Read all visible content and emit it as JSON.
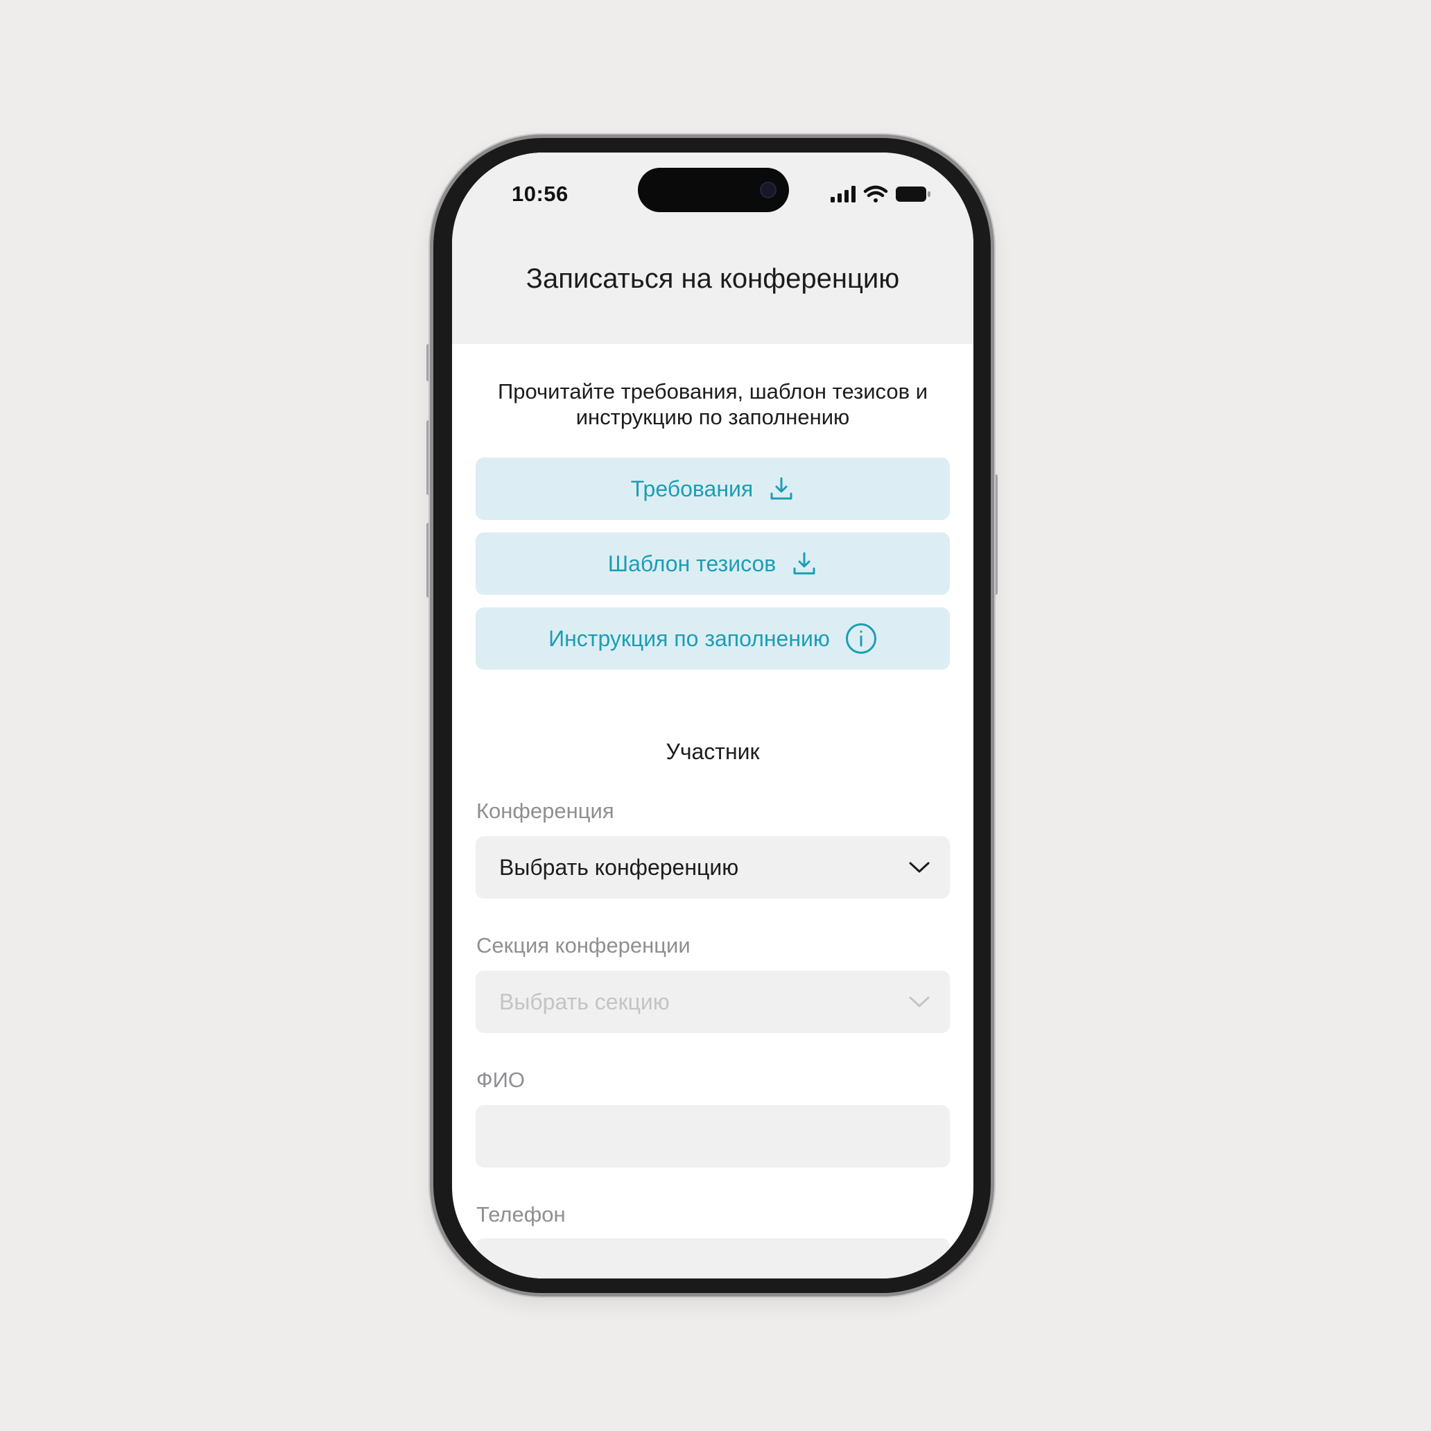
{
  "status_bar": {
    "time": "10:56",
    "icons": [
      "cellular-signal-icon",
      "wifi-icon",
      "battery-icon"
    ]
  },
  "header": {
    "title": "Записаться на конференцию"
  },
  "intro": {
    "text": "Прочитайте требования, шаблон тезисов и инструкцию по заполнению"
  },
  "document_buttons": [
    {
      "label": "Требования",
      "icon": "download-icon"
    },
    {
      "label": "Шаблон тезисов",
      "icon": "download-icon"
    },
    {
      "label": "Инструкция по заполнению",
      "icon": "info-icon"
    }
  ],
  "participant": {
    "heading": "Участник",
    "fields": [
      {
        "label": "Конференция",
        "value": "Выбрать конференцию",
        "type": "select",
        "enabled": true
      },
      {
        "label": "Секция конференции",
        "value": "Выбрать секцию",
        "type": "select",
        "enabled": false
      },
      {
        "label": "ФИО",
        "value": "",
        "type": "text"
      },
      {
        "label": "Телефон",
        "value": "",
        "type": "text"
      }
    ]
  },
  "colors": {
    "accent": "#1c9db5",
    "button_bg": "#dceef3",
    "field_bg": "#f0f0f0",
    "label": "#8e8e93",
    "page_bg": "#eeedeb"
  }
}
